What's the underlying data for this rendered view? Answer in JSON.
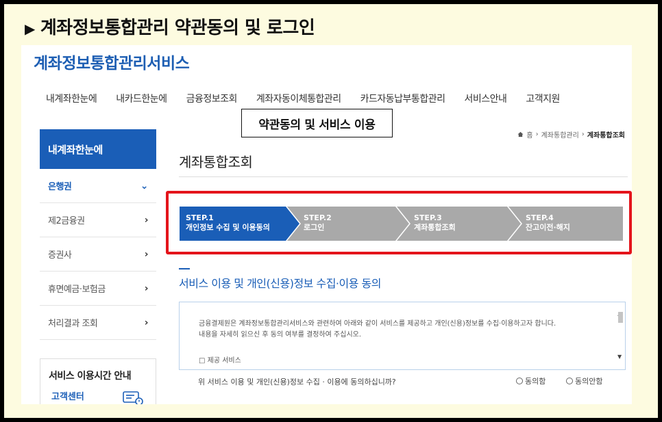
{
  "slide": {
    "title": "계좌정보통합관리 약관동의 및 로그인"
  },
  "site": {
    "brand": "계좌정보통합관리서비스"
  },
  "gnb": [
    "내계좌한눈에",
    "내카드한눈에",
    "금융정보조회",
    "계좌자동이체통합관리",
    "카드자동납부통합관리",
    "서비스안내",
    "고객지원"
  ],
  "callout": "약관동의 및 서비스 이용",
  "lnb": {
    "header": "내계좌한눈에",
    "items": [
      {
        "label": "은행권",
        "active": true
      },
      {
        "label": "제2금융권",
        "active": false
      },
      {
        "label": "증권사",
        "active": false
      },
      {
        "label": "휴면예금·보험금",
        "active": false
      },
      {
        "label": "처리결과 조회",
        "active": false
      }
    ]
  },
  "info": {
    "title": "서비스 이용시간 안내",
    "sub": "고객센터"
  },
  "breadcrumb": {
    "home": "홈",
    "parent": "계좌통합관리",
    "current": "계좌통합조회"
  },
  "page_title": "계좌통합조회",
  "steps": [
    {
      "num": "STEP.1",
      "label": "개인정보 수집 및 이용동의",
      "active": true
    },
    {
      "num": "STEP.2",
      "label": "로그인",
      "active": false
    },
    {
      "num": "STEP.3",
      "label": "계좌통합조회",
      "active": false
    },
    {
      "num": "STEP.4",
      "label": "잔고이전·해지",
      "active": false
    }
  ],
  "section_title": "서비스 이용 및 개인(신용)정보 수집·이용 동의",
  "terms": {
    "line1": "금융결제원은 계좌정보통합관리서비스와 관련하여 아래와 같이 서비스를 제공하고 개인(신용)정보를 수집·이용하고자 합니다.",
    "line2": "내용을 자세히 읽으신 후 동의 여부를 결정하여 주십시오.",
    "item": "□ 제공 서비스"
  },
  "consent": {
    "question": "위 서비스 이용 및 개인(신용)정보 수집 · 이용에 동의하십니까?",
    "agree": "동의함",
    "disagree": "동의안함"
  },
  "colors": {
    "brand": "#1d5eb3",
    "step_active": "#1a5eb7",
    "step_inactive": "#a9a9a9",
    "highlight": "#e4141b"
  }
}
